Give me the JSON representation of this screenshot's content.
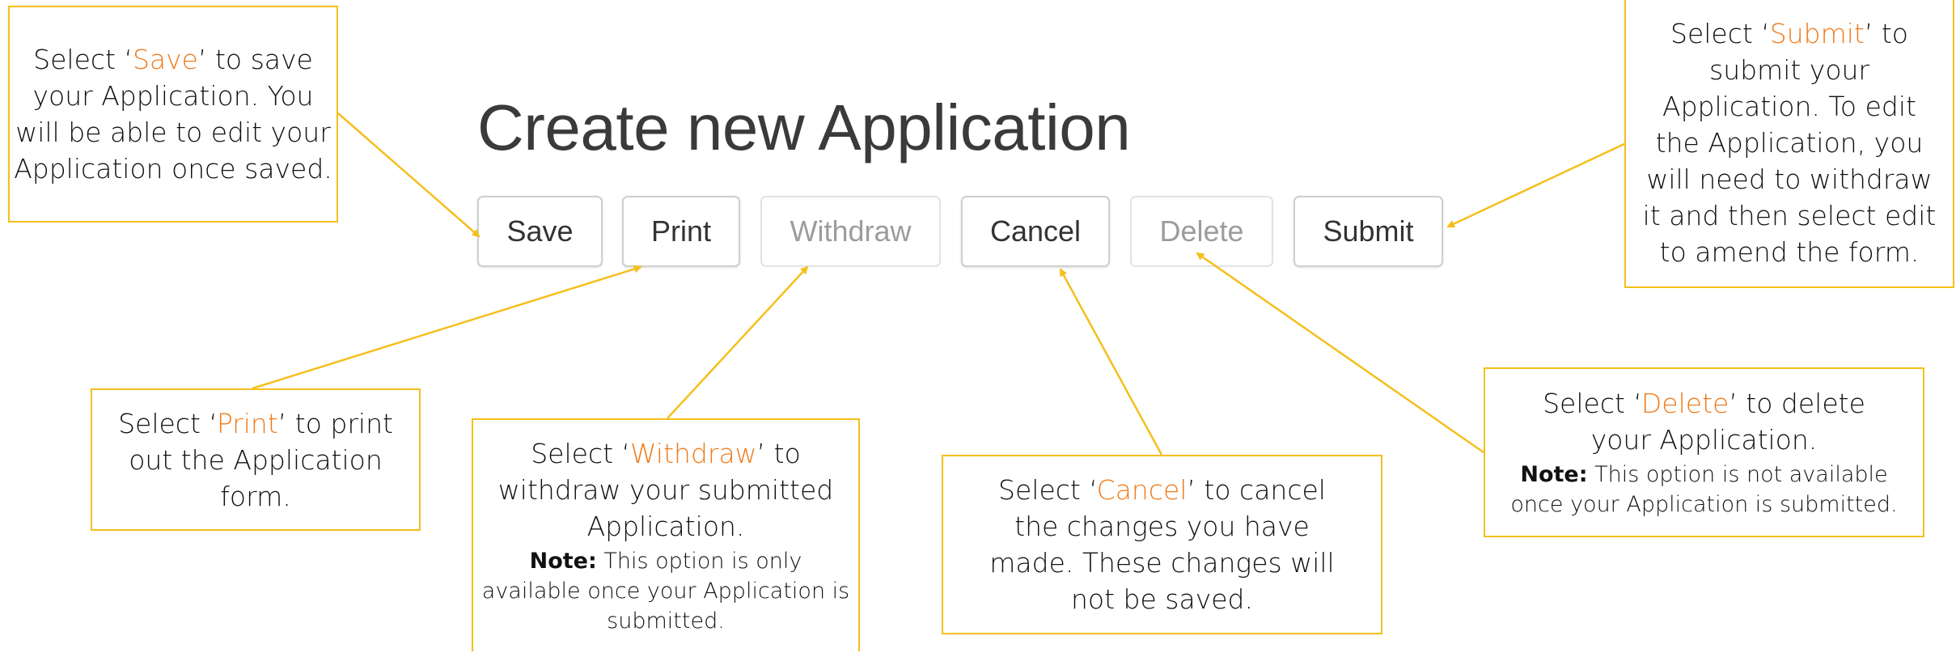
{
  "page": {
    "title": "Create new Application"
  },
  "toolbar": {
    "buttons": [
      {
        "label": "Save",
        "enabled": true
      },
      {
        "label": "Print",
        "enabled": true
      },
      {
        "label": "Withdraw",
        "enabled": false
      },
      {
        "label": "Cancel",
        "enabled": true
      },
      {
        "label": "Delete",
        "enabled": false
      },
      {
        "label": "Submit",
        "enabled": true
      }
    ]
  },
  "callouts": {
    "save": {
      "pre": "Select ‘",
      "keyword": "Save",
      "post": "’ to save your Application. You will be able to edit your Application once saved."
    },
    "print": {
      "pre": "Select ‘",
      "keyword": "Print",
      "post": "’ to print out the Application form."
    },
    "withdraw": {
      "pre": "Select ‘",
      "keyword": "Withdraw",
      "post": "’ to withdraw your submitted Application.",
      "note_label": "Note:",
      "note_text": " This option is only available once your Application is submitted."
    },
    "cancel": {
      "pre": "Select ‘",
      "keyword": "Cancel",
      "post": "’ to cancel the changes you have made. These changes will not be saved."
    },
    "delete": {
      "pre": "Select ‘",
      "keyword": "Delete",
      "post": "’ to delete your Application.",
      "note_label": "Note:",
      "note_text": " This option is not available once your Application is submitted."
    },
    "submit": {
      "pre": "Select ‘",
      "keyword": "Submit",
      "post": "’ to submit your Application. To edit the Application, you will need to withdraw it and then select edit to amend the form."
    }
  },
  "colors": {
    "callout_border": "#f5bf1c",
    "keyword": "#ef7b1b",
    "title": "#3a3a3a",
    "button_text": "#333333",
    "button_disabled_text": "#9c9c9c"
  }
}
